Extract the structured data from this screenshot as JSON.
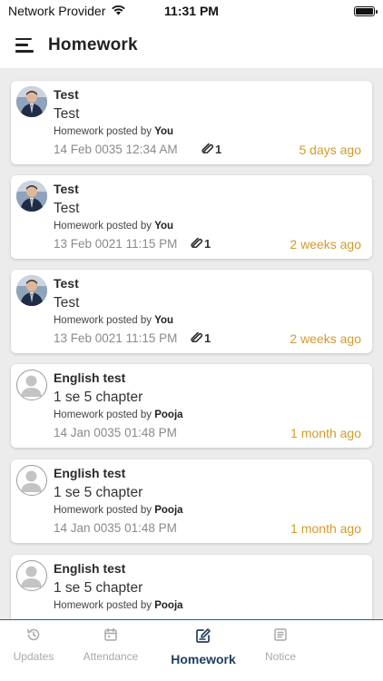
{
  "status_bar": {
    "carrier": "Network Provider",
    "time": "11:31 PM"
  },
  "header": {
    "title": "Homework"
  },
  "posted_prefix": "Homework posted by ",
  "cards": [
    {
      "title": "Test",
      "description": "Test",
      "posted_by": "You",
      "date": "14 Feb 0035 12:34 AM",
      "attachments": "1",
      "ago": "5 days ago",
      "avatar": "photo"
    },
    {
      "title": "Test",
      "description": "Test",
      "posted_by": "You",
      "date": "13 Feb 0021 11:15 PM",
      "attachments": "1",
      "ago": "2 weeks ago",
      "avatar": "photo"
    },
    {
      "title": "Test",
      "description": "Test",
      "posted_by": "You",
      "date": "13 Feb 0021 11:15 PM",
      "attachments": "1",
      "ago": "2 weeks ago",
      "avatar": "photo"
    },
    {
      "title": "English test",
      "description": "1 se 5 chapter",
      "posted_by": "Pooja",
      "date": "14 Jan 0035 01:48 PM",
      "attachments": "",
      "ago": "1 month ago",
      "avatar": "placeholder"
    },
    {
      "title": "English test",
      "description": "1 se 5 chapter",
      "posted_by": "Pooja",
      "date": "14 Jan 0035 01:48 PM",
      "attachments": "",
      "ago": "1 month ago",
      "avatar": "placeholder"
    },
    {
      "title": "English test",
      "description": "1 se 5 chapter",
      "posted_by": "Pooja",
      "date": "",
      "attachments": "",
      "ago": "",
      "avatar": "placeholder"
    }
  ],
  "bottom_nav": {
    "items": [
      {
        "label": "Updates",
        "icon": "history-icon",
        "active": false
      },
      {
        "label": "Attendance",
        "icon": "calendar-icon",
        "active": false
      },
      {
        "label": "Homework",
        "icon": "edit-icon",
        "active": true
      },
      {
        "label": "Notice",
        "icon": "notice-icon",
        "active": false
      }
    ]
  },
  "colors": {
    "accent": "#1f3f62",
    "time_ago": "#d39a2c",
    "background": "#ececec"
  }
}
